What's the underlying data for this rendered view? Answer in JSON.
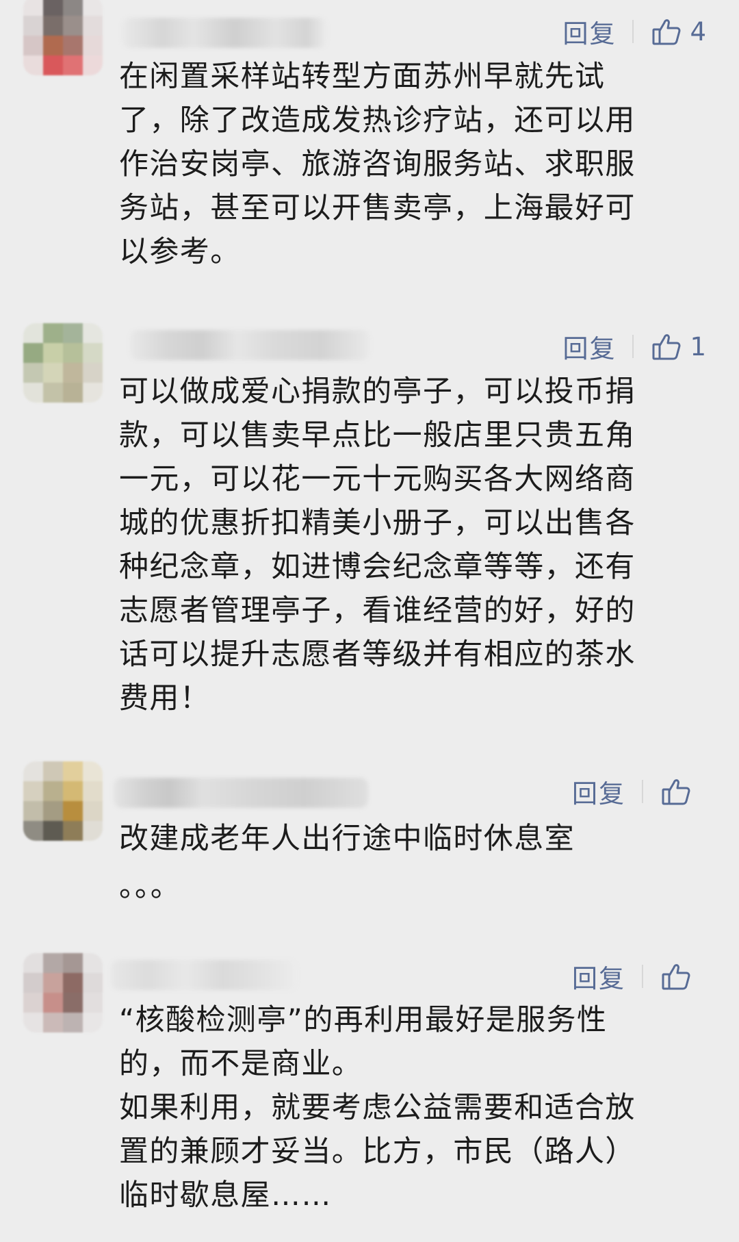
{
  "comments": [
    {
      "reply_label": "回复",
      "like_count": "4",
      "text": "在闲置采样站转型方面苏州早就先试\n了，除了改造成发热诊疗站，还可以用\n作治安岗亭、旅游咨询服务站、求职服\n务站，甚至可以开售卖亭，上海最好可\n以参考。"
    },
    {
      "reply_label": "回复",
      "like_count": "1",
      "text": "可以做成爱心捐款的亭子，可以投币捐\n款，可以售卖早点比一般店里只贵五角\n一元，可以花一元十元购买各大网络商\n城的优惠折扣精美小册子，可以出售各\n种纪念章，如进博会纪念章等等，还有\n志愿者管理亭子，看谁经营的好，好的\n话可以提升志愿者等级并有相应的茶水\n费用！"
    },
    {
      "reply_label": "回复",
      "like_count": "",
      "text": "改建成老年人出行途中临时休息室\n。。。"
    },
    {
      "reply_label": "回复",
      "like_count": "",
      "text": "“核酸检测亭”的再利用最好是服务性\n的，而不是商业。\n如果利用，就要考虑公益需要和适合放\n置的兼顾才妥当。比方，市民（路人）\n临时歇息屋……"
    }
  ],
  "colors": {
    "background": "#ededed",
    "link": "#576b95",
    "text": "#1c1c1c"
  },
  "icons": {
    "like": "thumbs-up-icon"
  }
}
